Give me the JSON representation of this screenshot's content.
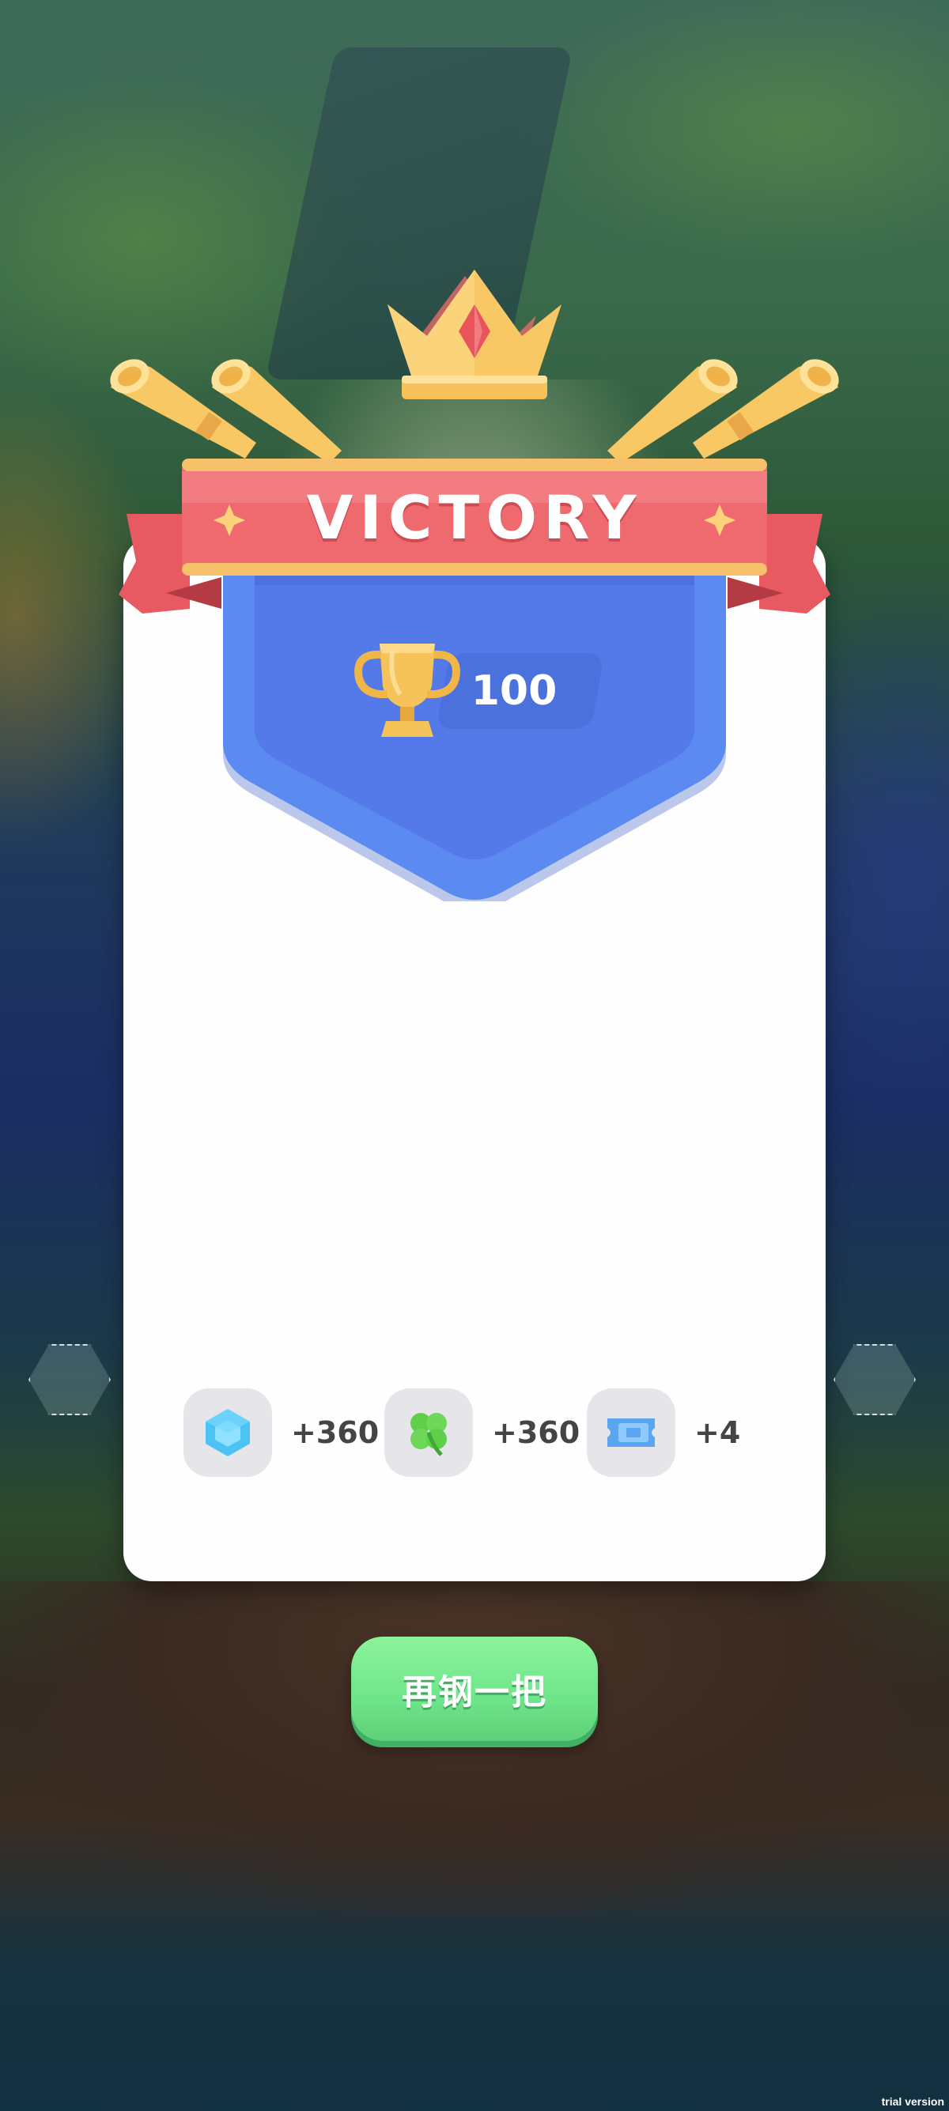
{
  "banner": {
    "title": "VICTORY"
  },
  "score": {
    "value": "100",
    "icon": "trophy-icon"
  },
  "rewards": [
    {
      "icon": "gem-icon",
      "amount": "+360"
    },
    {
      "icon": "clover-icon",
      "amount": "+360"
    },
    {
      "icon": "ticket-icon",
      "amount": "+4"
    }
  ],
  "actions": {
    "play_again_label": "再钢一把"
  },
  "watermark": "trial version",
  "colors": {
    "banner_red": "#ee6a6e",
    "shield_blue": "#5b8bf0",
    "button_green": "#7ceb90",
    "gold": "#f7c25c"
  }
}
